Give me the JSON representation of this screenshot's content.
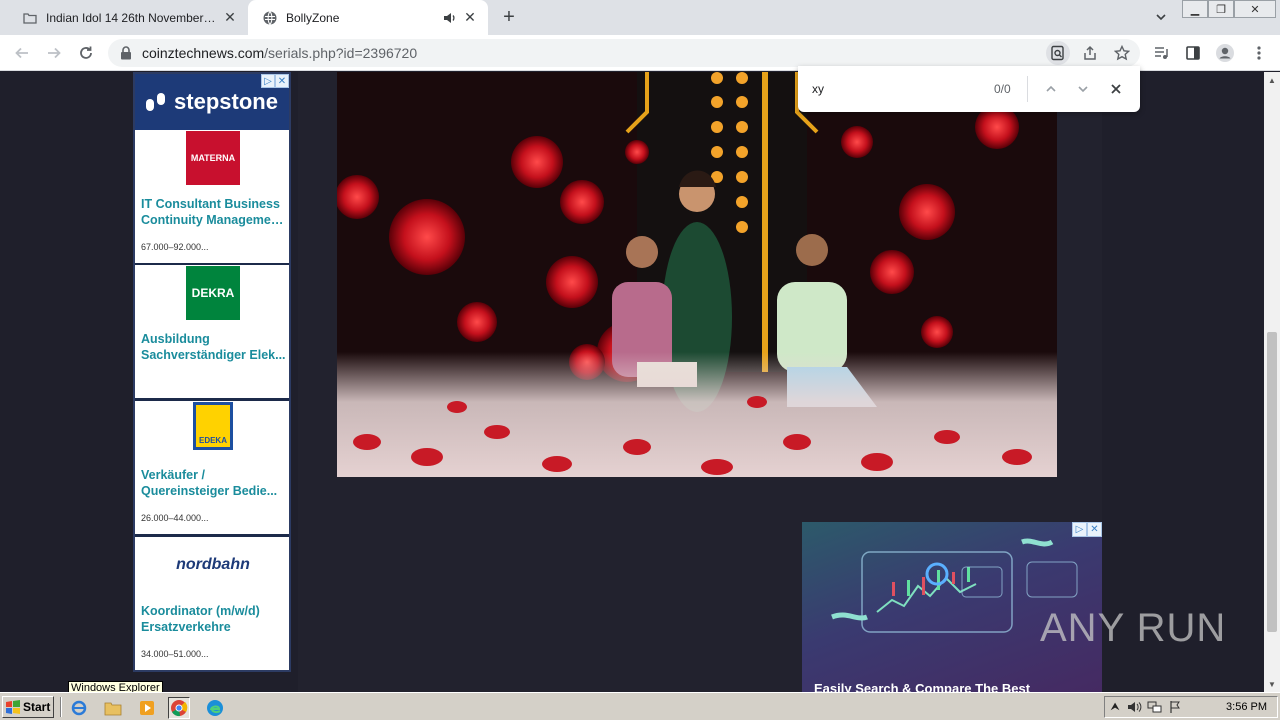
{
  "browser": {
    "tabs": [
      {
        "title": "Indian Idol 14 26th November 2023",
        "active": false
      },
      {
        "title": "BollyZone",
        "active": true
      }
    ],
    "url_host": "coinztechnews.com",
    "url_path": "/serials.php?id=2396720"
  },
  "findbar": {
    "query": "xy",
    "count": "0/0"
  },
  "left_ad": {
    "brand": "stepstone",
    "jobs": [
      {
        "logo_text": "MATERNA",
        "title_line1": "IT Consultant Business",
        "title_line2": "Continuity Managemen...",
        "salary": "67.000–92.000..."
      },
      {
        "logo_text": "DEKRA",
        "title_line1": "Ausbildung",
        "title_line2": "Sachverständiger Elek...",
        "salary": ""
      },
      {
        "logo_text": "EDEKA",
        "title_line1": "Verkäufer /",
        "title_line2": "Quereinsteiger Bedie...",
        "salary": "26.000–44.000..."
      },
      {
        "logo_text": "nordbahn",
        "title_line1": "Koordinator (m/w/d)",
        "title_line2": "Ersatzverkehre",
        "salary": "34.000–51.000..."
      }
    ]
  },
  "right_ad": {
    "caption": "Easily Search & Compare The Best"
  },
  "watermark": "ANY RUN",
  "taskbar": {
    "start_label": "Start",
    "clock": "3:56 PM",
    "tooltip": "Windows Explorer"
  },
  "colors": {
    "page_bg": "#1f1f2b",
    "link_teal": "#1a8c9c",
    "stepstone_blue": "#1d3a78",
    "materna_red": "#c8102e",
    "dekra_green": "#00843d",
    "edeka_yellow": "#ffd200"
  }
}
